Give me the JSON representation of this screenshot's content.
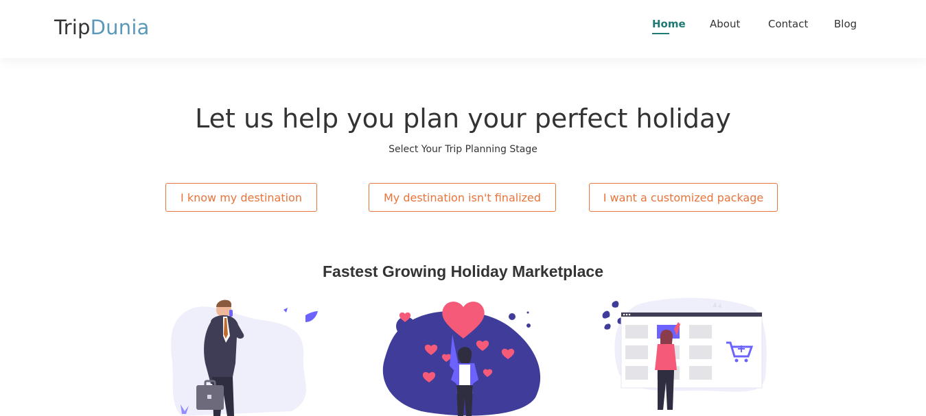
{
  "brand": {
    "part1": "Trip",
    "part2": "Dunia"
  },
  "nav": {
    "items": [
      {
        "label": "Home",
        "active": true
      },
      {
        "label": "About",
        "active": false
      },
      {
        "label": "Contact",
        "active": false
      },
      {
        "label": "Blog",
        "active": false
      }
    ]
  },
  "hero": {
    "title": "Let us help you plan your perfect holiday",
    "subtitle": "Select Your Trip Planning Stage"
  },
  "stages": [
    {
      "label": "I know my destination"
    },
    {
      "label": "My destination isn't finalized"
    },
    {
      "label": "I want a customized package"
    }
  ],
  "marketplace": {
    "title": "Fastest Growing Holiday Marketplace"
  },
  "colors": {
    "brand_dark": "#333333",
    "brand_accent": "#5b98b9",
    "nav_active": "#1e7a74",
    "button_orange": "#e8743b",
    "illustration_purple": "#3f3d99",
    "illustration_pink": "#f65a79"
  },
  "illustrations": [
    {
      "icon": "businessman-illustration"
    },
    {
      "icon": "love-hearts-illustration"
    },
    {
      "icon": "online-shopping-illustration"
    }
  ]
}
